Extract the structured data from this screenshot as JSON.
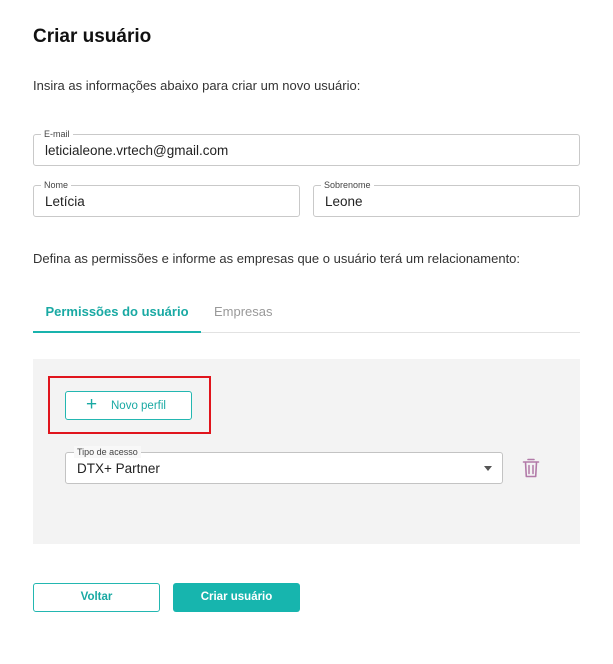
{
  "page": {
    "title": "Criar usuário",
    "intro": "Insira as informações abaixo para criar um novo usuário:",
    "permissions_description": "Defina as permissões e informe as empresas que o usuário terá um relacionamento:"
  },
  "form": {
    "email": {
      "label": "E-mail",
      "value": "leticialeone.vrtech@gmail.com"
    },
    "first_name": {
      "label": "Nome",
      "value": "Letícia"
    },
    "last_name": {
      "label": "Sobrenome",
      "value": "Leone"
    }
  },
  "tabs": [
    {
      "label": "Permissões do usuário",
      "active": true
    },
    {
      "label": "Empresas",
      "active": false
    }
  ],
  "permissions": {
    "new_profile_button": "Novo perfil",
    "access_type": {
      "label": "Tipo de acesso",
      "value": "DTX+ Partner"
    }
  },
  "actions": {
    "back": "Voltar",
    "create": "Criar usuário"
  },
  "icons": {
    "add": "plus-icon",
    "dropdown": "caret-down-icon",
    "delete": "trash-icon"
  },
  "colors": {
    "accent": "#17b5ae",
    "highlight_box": "#e0141c",
    "trash_icon": "#b27aa8",
    "panel_bg": "#f3f3f3"
  }
}
